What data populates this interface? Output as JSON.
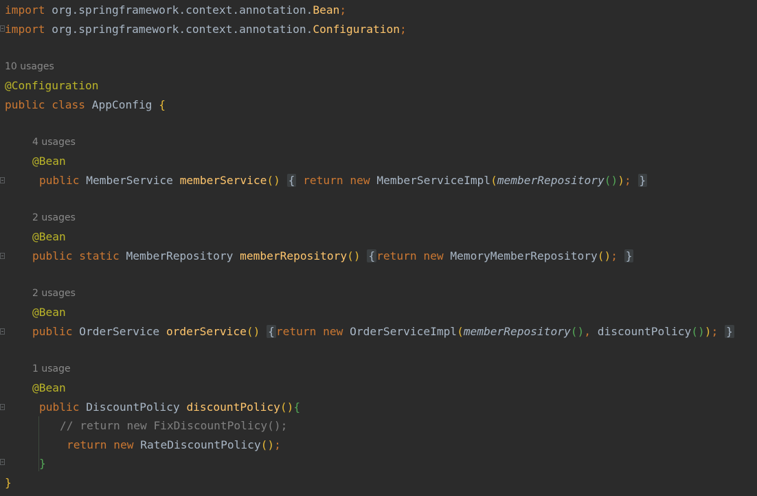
{
  "code": {
    "import1": {
      "kw": "import",
      "pkg": "org.springframework.context.annotation.",
      "cls": "Bean",
      "semi": ";"
    },
    "import2": {
      "kw": "import",
      "pkg": "org.springframework.context.annotation.",
      "cls": "Configuration",
      "semi": ";"
    },
    "class_hint": "10 usages",
    "class_annotation": "@Configuration",
    "class_decl": {
      "kw1": "public",
      "kw2": "class",
      "name": "AppConfig",
      "brace": "{"
    },
    "member_service": {
      "hint": "4 usages",
      "annotation": "@Bean",
      "mod": "public",
      "type": "MemberService",
      "name": "memberService",
      "parens": "()",
      "open": "{",
      "ret": "return",
      "new_kw": "new",
      "impl": "MemberServiceImpl",
      "arg": "memberRepository",
      "tail": "());",
      "close": "}"
    },
    "member_repository": {
      "hint": "2 usages",
      "annotation": "@Bean",
      "mod": "public",
      "mod2": "static",
      "type": "MemberRepository",
      "name": "memberRepository",
      "parens": "()",
      "open": "{",
      "ret": "return",
      "new_kw": "new",
      "impl": "MemoryMemberRepository",
      "tail": "();",
      "close": "}"
    },
    "order_service": {
      "hint": "2 usages",
      "annotation": "@Bean",
      "mod": "public",
      "type": "OrderService",
      "name": "orderService",
      "parens": "()",
      "open": "{",
      "ret": "return",
      "new_kw": "new",
      "impl": "OrderServiceImpl",
      "arg1": "memberRepository",
      "sep": "(), ",
      "arg2": "discountPolicy",
      "tail": "());",
      "close": "}"
    },
    "discount_policy": {
      "hint": "1 usage",
      "annotation": "@Bean",
      "mod": "public",
      "type": "DiscountPolicy",
      "name": "discountPolicy",
      "parens": "()",
      "open": "{",
      "comment": "// return new FixDiscountPolicy();",
      "ret": "return",
      "new_kw": "new",
      "impl": "RateDiscountPolicy",
      "tail": "();",
      "close": "}"
    },
    "class_close": "}"
  }
}
